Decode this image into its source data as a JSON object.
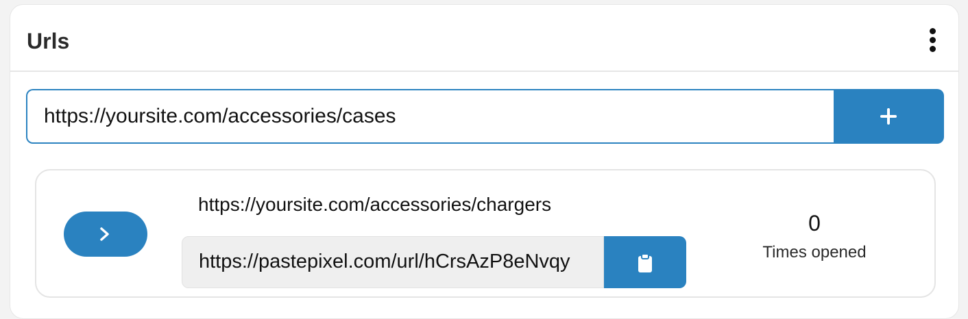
{
  "header": {
    "title": "Urls",
    "menu_icon": "more-vertical-icon"
  },
  "new_url": {
    "value": "https://yoursite.com/accessories/cases",
    "add_icon": "plus-icon"
  },
  "urls": [
    {
      "original_url": "https://yoursite.com/accessories/chargers",
      "short_url": "https://pastepixel.com/url/hCrsAzP8eNvqy",
      "open_icon": "chevron-right-icon",
      "copy_icon": "clipboard-icon",
      "times_opened": "0",
      "times_opened_label": "Times opened"
    }
  ],
  "colors": {
    "accent": "#2a82c0",
    "card_border": "#e6e6e6",
    "short_url_bg": "#efefef"
  }
}
